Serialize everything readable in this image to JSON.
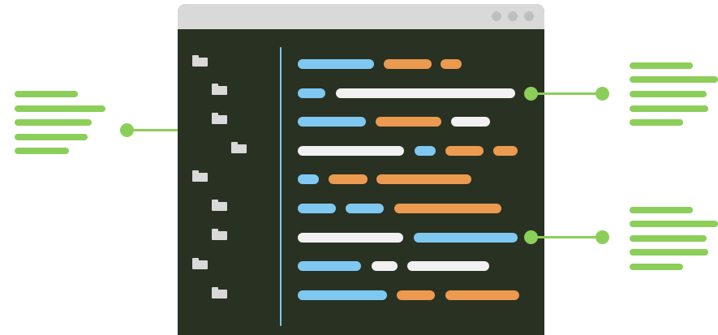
{
  "colors": {
    "editor_background": "#293122",
    "titlebar": "#d9d9d9",
    "folder": "#d9d9d9",
    "divider": "#7cc7f0",
    "code_blue": "#7fc8f2",
    "code_orange": "#ec9a4f",
    "code_white": "#f1f1f1",
    "callout_green": "#8cce5a"
  },
  "icons": {
    "folder": "folder-icon",
    "window_control": "window-control-dot"
  }
}
